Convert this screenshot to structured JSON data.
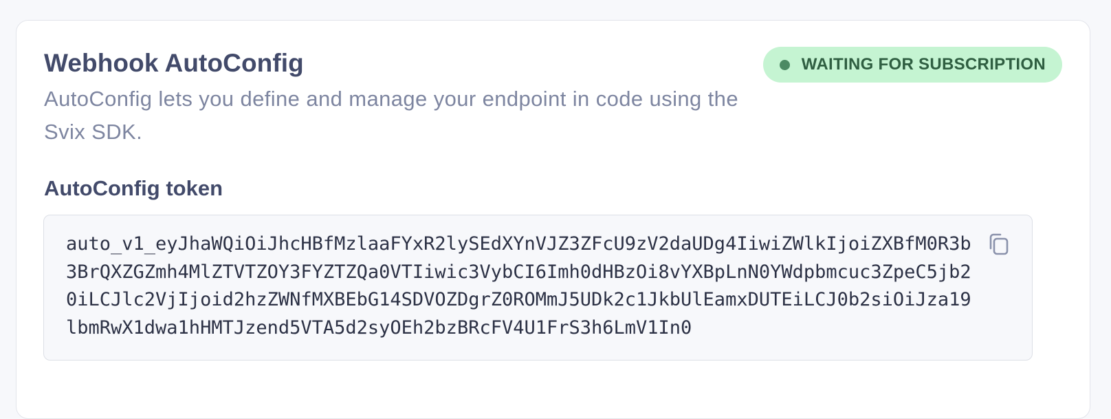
{
  "card": {
    "title": "Webhook AutoConfig",
    "description": "AutoConfig lets you define and manage your endpoint in code using the Svix SDK.",
    "status": {
      "label": "WAITING FOR SUBSCRIPTION",
      "color": "#c5f4d2",
      "dot_color": "#4c8a63"
    },
    "token": {
      "label": "AutoConfig token",
      "value": "auto_v1_eyJhaWQiOiJhcHBfMzlaaFYxR2lySEdXYnVJZ3ZFcU9zV2daUDg4IiwiZWlkIjoiZXBfM0R3b3BrQXZGZmh4MlZTVTZOY3FYZTZQa0VTIiwic3VybCI6Imh0dHBzOi8vYXBpLnN0YWdpbmcuc3ZpeC5jb20iLCJlc2VjIjoid2hzZWNfMXBEbG14SDVOZDgrZ0ROMmJ5UDk2c1JkbUlEamxDUTEiLCJ0b2siOiJza19lbmRwX1dwa1hHMTJzend5VTA5d2syOEh2bzBRcFV4U1FrS3h6LmV1In0",
      "copy_icon": "copy-icon"
    }
  }
}
